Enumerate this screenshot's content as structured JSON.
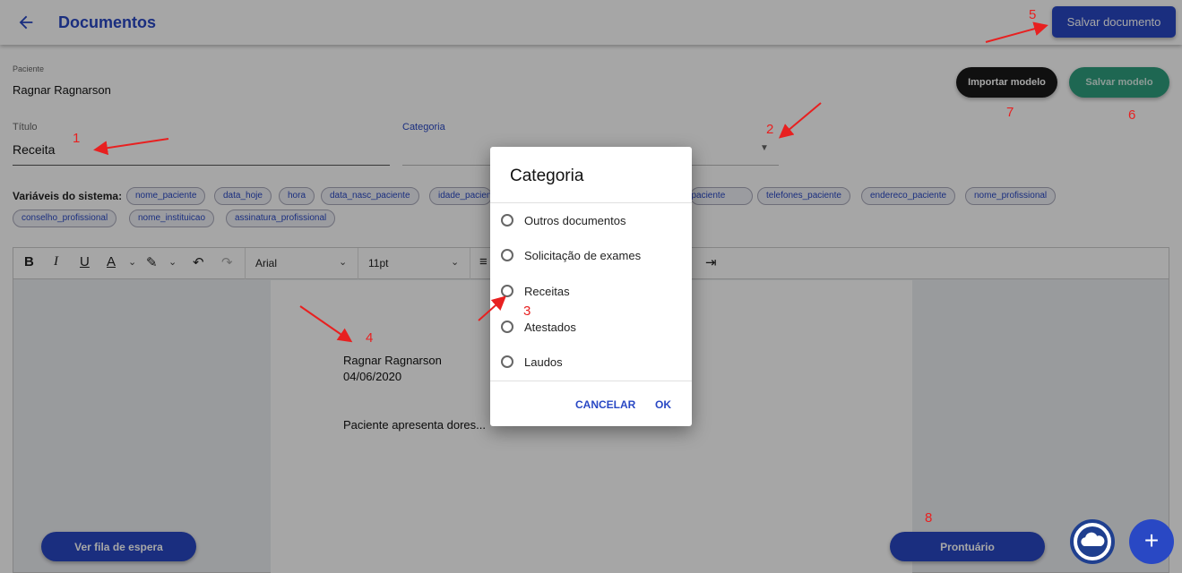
{
  "header": {
    "title": "Documentos",
    "save_document": "Salvar documento"
  },
  "form": {
    "patient_label": "Paciente",
    "patient_value": "Ragnar Ragnarson",
    "title_label": "Título",
    "title_value": "Receita",
    "category_label": "Categoria",
    "import_model": "Importar modelo",
    "save_model": "Salvar modelo"
  },
  "variables": {
    "label": "Variáveis do sistema:",
    "chips": [
      "nome_paciente",
      "data_hoje",
      "hora",
      "data_nasc_paciente",
      "idade_paciente",
      "rg_paciente",
      "telefones_paciente",
      "endereco_paciente",
      "nome_profissional",
      "conselho_profissional",
      "nome_instituicao",
      "assinatura_profissional"
    ]
  },
  "editor": {
    "font": "Arial",
    "size": "11pt",
    "lines": [
      "Ragnar Ragnarson",
      "04/06/2020",
      "Paciente apresenta dores..."
    ]
  },
  "dialog": {
    "title": "Categoria",
    "options": [
      "Outros documentos",
      "Solicitação de exames",
      "Receitas",
      "Atestados",
      "Laudos"
    ],
    "cancel": "CANCELAR",
    "ok": "OK"
  },
  "bottom": {
    "queue": "Ver fila de espera",
    "record": "Prontuário"
  },
  "annotations": [
    "1",
    "2",
    "3",
    "4",
    "5",
    "6",
    "7",
    "8"
  ],
  "colors": {
    "primary": "#2948c4",
    "green": "#2e9e7e",
    "dark": "#1a1a1a",
    "annotation": "#e82020"
  }
}
